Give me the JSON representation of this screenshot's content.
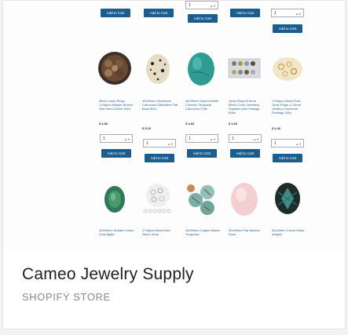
{
  "card": {
    "title": "Cameo Jewelry Supply",
    "subtitle": "SHOPIFY STORE"
  },
  "ui": {
    "add_to_cart": "Add to Cart",
    "qty_default": "1"
  },
  "products_row2": [
    {
      "name": "Mixed Jump Rings 1748pcs Antique Bronze Size 4mm-10mm 920s",
      "price": "$ 6.80"
    },
    {
      "name": "40x30mm Gemstone Cabochon Dalmation Flat Back 851x",
      "price": "$ 5.10"
    },
    {
      "name": "40x30mm Dyed Howlite Chinese Turquoise Cabochon 678x",
      "price": "$ 4.83"
    },
    {
      "name": "Jump Ring Kit 6mm Mixed Color Jewellery Supplies and Findings 636x",
      "price": "$ 4.60"
    },
    {
      "name": "1745pcs Mixed Gold Jump Rings 4-10mm Jewelry Connector Findings 150z",
      "price": "$ 4.30"
    }
  ],
  "products_row3": [
    {
      "name": "40x30mm Striated Green Oval Agate"
    },
    {
      "name": "1745pcs Mixed Size Silver Jump"
    },
    {
      "name": "40x30mm Copper Matrix Turquoise"
    },
    {
      "name": "40x30mm Flat Backed Rose"
    },
    {
      "name": "35x18mm Czech Glass Intaglio"
    }
  ],
  "colors": {
    "button": "#1c5d8f",
    "link": "#2b5f8e"
  }
}
